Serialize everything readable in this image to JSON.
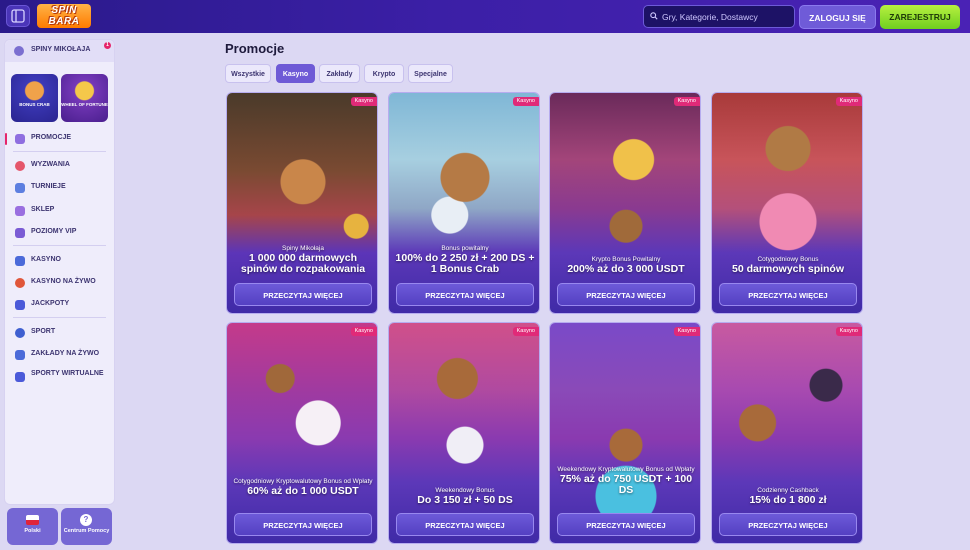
{
  "header": {
    "logo_text": "SPIN BARA",
    "search_placeholder": "Gry, Kategorie, Dostawcy",
    "login_label": "ZALOGUJ SIĘ",
    "register_label": "ZAREJESTRUJ"
  },
  "sidebar": {
    "top_item": {
      "label": "SPINY MIKOŁAJA",
      "badge": "1"
    },
    "tiles": [
      {
        "label": "BONUS CRAB"
      },
      {
        "label": "WHEEL OF FORTUNE"
      }
    ],
    "items": [
      {
        "label": "PROMOCJE",
        "icon": "gift-icon",
        "active": true
      },
      {
        "label": "WYZWANIA",
        "icon": "target-icon"
      },
      {
        "label": "TURNIEJE",
        "icon": "trophy-icon"
      },
      {
        "label": "SKLEP",
        "icon": "shop-icon"
      },
      {
        "label": "POZIOMY VIP",
        "icon": "crown-icon"
      },
      {
        "label": "KASYNO",
        "icon": "slot-icon"
      },
      {
        "label": "KASYNO NA ŻYWO",
        "icon": "live-icon"
      },
      {
        "label": "JACKPOTY",
        "icon": "jackpot-icon"
      },
      {
        "label": "SPORT",
        "icon": "ball-icon"
      },
      {
        "label": "ZAKŁADY NA ŻYWO",
        "icon": "live-bet-icon"
      },
      {
        "label": "SPORTY WIRTUALNE",
        "icon": "virtual-icon"
      }
    ],
    "bottom": {
      "language": "Polski",
      "help": "Centrum Pomocy"
    }
  },
  "main": {
    "title": "Promocje",
    "tabs": [
      "Wszystkie",
      "Kasyno",
      "Zakłady",
      "Krypto",
      "Specjalne"
    ],
    "active_tab": "Kasyno",
    "cards": [
      {
        "badge": "Kasyno",
        "subtitle": "Spiny Mikołaja",
        "title": "1 000 000 darmowych spinów do rozpakowania",
        "button": "PRZECZYTAJ WIĘCEJ"
      },
      {
        "badge": "Kasyno",
        "subtitle": "Bonus powitalny",
        "title": "100% do 2 250 zł + 200 DS + 1 Bonus Crab",
        "button": "PRZECZYTAJ WIĘCEJ"
      },
      {
        "badge": "Kasyno",
        "subtitle": "Krypto Bonus Powitalny",
        "title": "200% aż do 3 000 USDT",
        "button": "PRZECZYTAJ WIĘCEJ"
      },
      {
        "badge": "Kasyno",
        "subtitle": "Cotygodniowy Bonus",
        "title": "50 darmowych spinów",
        "button": "PRZECZYTAJ WIĘCEJ"
      },
      {
        "badge": "Kasyno",
        "subtitle": "Cotygodniowy Kryptowalutowy Bonus od Wpłaty",
        "title": "60% aż do 1 000 USDT",
        "button": "PRZECZYTAJ WIĘCEJ"
      },
      {
        "badge": "Kasyno",
        "subtitle": "Weekendowy Bonus",
        "title": "Do 3 150 zł + 50 DS",
        "button": "PRZECZYTAJ WIĘCEJ"
      },
      {
        "badge": "Kasyno",
        "subtitle": "Weekendowy Kryptowalutowy Bonus od Wpłaty",
        "title": "75% aż do 750 USDT + 100 DS",
        "button": "PRZECZYTAJ WIĘCEJ"
      },
      {
        "badge": "Kasyno",
        "subtitle": "Codzienny Cashback",
        "title": "15% do 1 800 zł",
        "button": "PRZECZYTAJ WIĘCEJ"
      }
    ]
  },
  "colors": {
    "header_bg": "#3b1fa6",
    "accent": "#6e5ad6",
    "register_green": "#8fdc2c",
    "badge_pink": "#e02a78"
  }
}
